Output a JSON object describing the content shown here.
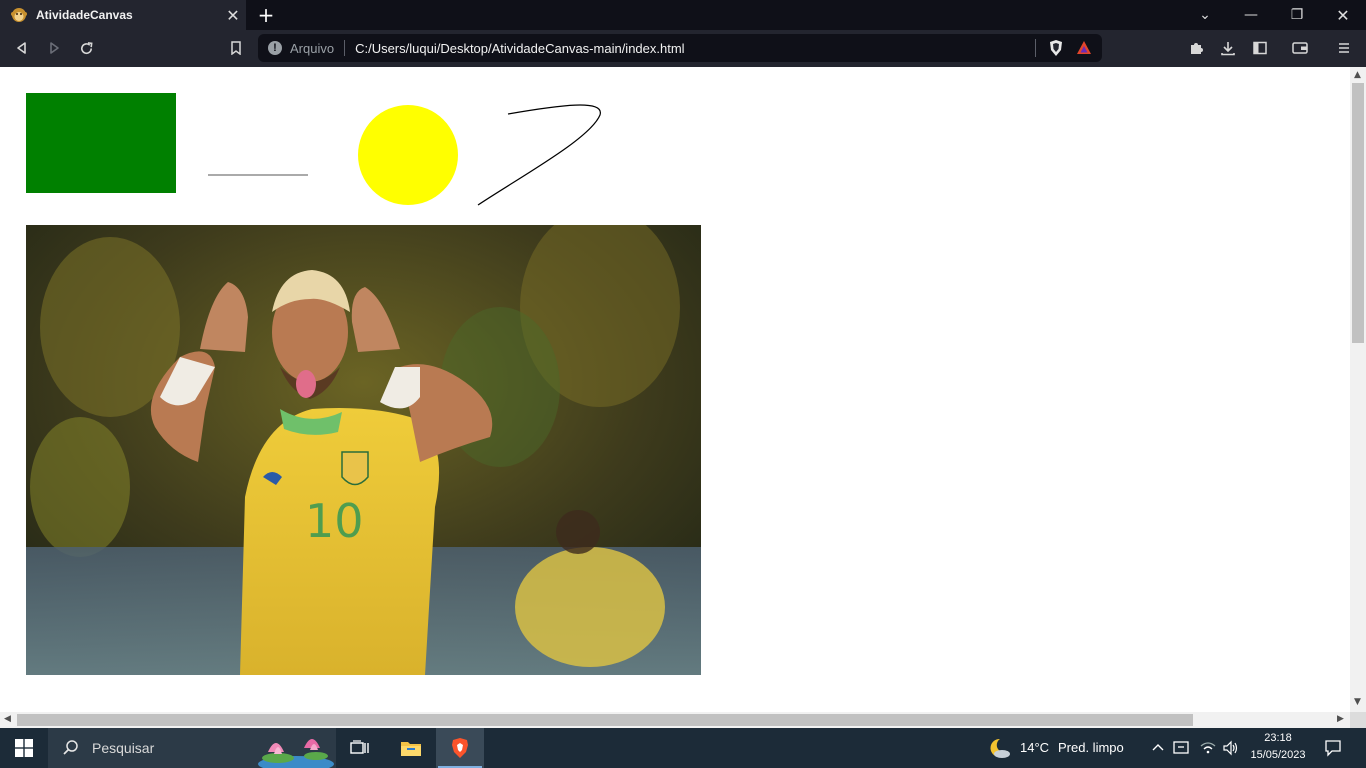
{
  "colors": {
    "tab_strip": "#0f1018",
    "toolbar": "#23252f",
    "rect_fill": "#008000",
    "circle_fill": "#ffff00",
    "taskbar": "#1c2b38"
  },
  "tab": {
    "title": "AtividadeCanvas",
    "favicon": "monkey-favicon-icon",
    "close_symbol": "✕"
  },
  "new_tab_symbol": "+",
  "window_controls": {
    "dropdown": "⌄",
    "minimize": "—",
    "restore": "❐",
    "close": "✕"
  },
  "address_bar": {
    "scheme_label": "Arquivo",
    "url": "C:/Users/luqui/Desktop/AtividadeCanvas-main/index.html",
    "info_symbol": "!"
  },
  "canvas": {
    "shapes": [
      "green-rectangle",
      "gray-line",
      "yellow-circle",
      "black-curve"
    ],
    "photo": "soccer-player-photo"
  },
  "taskbar": {
    "search_placeholder": "Pesquisar",
    "weather_temp": "14°C",
    "weather_desc": "Pred. limpo",
    "time": "23:18",
    "date": "15/05/2023"
  }
}
